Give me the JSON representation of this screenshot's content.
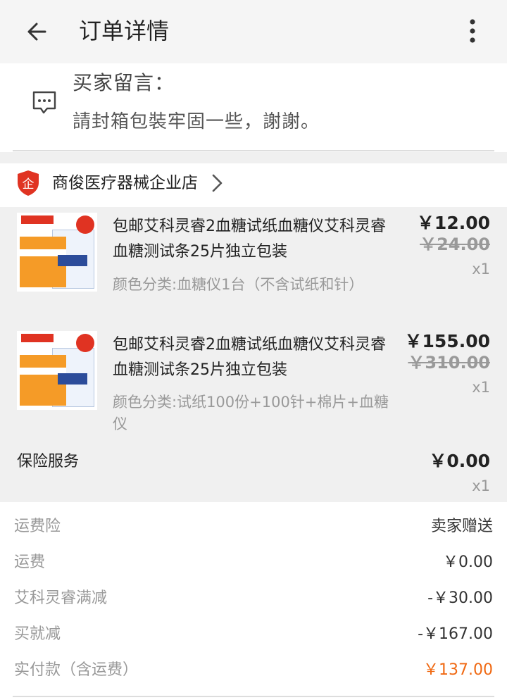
{
  "header": {
    "title": "订单详情",
    "back_icon": "arrow-left-icon",
    "more_icon": "more-vertical-icon"
  },
  "buyer_message": {
    "label": "买家留言：",
    "text": "請封箱包裝牢固一些，謝謝。",
    "icon": "chat-bubble-icon"
  },
  "shop": {
    "name": "商俊医疗器械企业店",
    "badge_icon": "enterprise-shield-icon",
    "badge_text": "企",
    "badge_color": "#e03322"
  },
  "items": [
    {
      "name": "包邮艾科灵睿2血糖试纸血糖仪艾科灵睿血糖测试条25片独立包装",
      "sku": "颜色分类:血糖仪1台（不含试纸和针）",
      "price": "￥12.00",
      "original_price": "￥24.00",
      "quantity": "x1"
    },
    {
      "name": "包邮艾科灵睿2血糖试纸血糖仪艾科灵睿血糖测试条25片独立包装",
      "sku": "颜色分类:试纸100份+100针+棉片+血糖仪",
      "price": "￥155.00",
      "original_price": "￥310.00",
      "quantity": "x1"
    }
  ],
  "insurance": {
    "label": "保险服务",
    "price": "￥0.00",
    "quantity": "x1"
  },
  "summary": [
    {
      "label": "运费险",
      "value": "卖家赠送"
    },
    {
      "label": "运费",
      "value": "￥0.00"
    },
    {
      "label": "艾科灵睿满减",
      "value": "-￥30.00"
    },
    {
      "label": "买就减",
      "value": "-￥167.00"
    },
    {
      "label": "实付款（含运费）",
      "value": "￥137.00"
    }
  ],
  "colors": {
    "accent_orange": "#f06a14",
    "header_bg": "#f5f5f5",
    "item_bg": "#f0f0f0"
  }
}
